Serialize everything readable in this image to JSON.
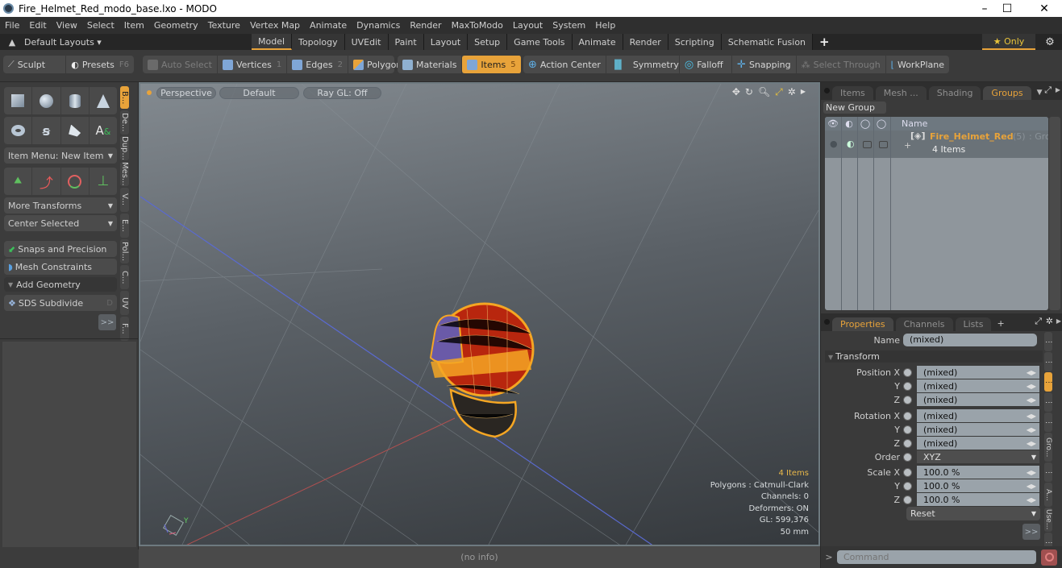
{
  "window": {
    "title": "Fire_Helmet_Red_modo_base.lxo - MODO",
    "controls": {
      "minimize": "–",
      "maximize": "☐",
      "close": "✕"
    }
  },
  "menu": [
    "File",
    "Edit",
    "View",
    "Select",
    "Item",
    "Geometry",
    "Texture",
    "Vertex Map",
    "Animate",
    "Dynamics",
    "Render",
    "MaxToModo",
    "Layout",
    "System",
    "Help"
  ],
  "layouts": {
    "selector": "Default Layouts ▾",
    "tabs": [
      "Model",
      "Topology",
      "UVEdit",
      "Paint",
      "Layout",
      "Setup",
      "Game Tools",
      "Animate",
      "Render",
      "Scripting",
      "Schematic Fusion"
    ],
    "active_tab": "Model",
    "add": "+",
    "only": "★ Only",
    "gear": "⚙"
  },
  "toolbar": {
    "sculpt": "Sculpt",
    "presets": "Presets",
    "presets_key": "F6",
    "auto_select": "Auto Select",
    "vertices": "Vertices",
    "vertices_key": "1",
    "edges": "Edges",
    "edges_key": "2",
    "polygons": "Polygons",
    "materials": "Materials",
    "items": "Items",
    "items_key": "5",
    "action_center": "Action Center",
    "symmetry": "Symmetry",
    "falloff": "Falloff",
    "snapping": "Snapping",
    "select_through": "Select Through",
    "workplane": "WorkPlane"
  },
  "left_panel": {
    "item_menu": "Item Menu: New Item",
    "more_transforms": "More Transforms",
    "center_selected": "Center Selected",
    "snaps_precision": "Snaps and Precision",
    "mesh_constraints": "Mesh Constraints",
    "add_geometry": "Add Geometry",
    "sds_subdivide": "SDS Subdivide",
    "sds_key": "D",
    "more": ">>",
    "vtabs": [
      "B...",
      "De...",
      "Dup...",
      "Mes...",
      "V...",
      "E...",
      "Pol...",
      "C...",
      "UV",
      "F..."
    ]
  },
  "viewport": {
    "view": "Perspective",
    "shading": "Default",
    "raygl": "Ray GL: Off",
    "info": {
      "items": "4 Items",
      "polygons": "Polygons : Catmull-Clark",
      "channels": "Channels: 0",
      "deformers": "Deformers: ON",
      "gl": "GL: 599,376",
      "scale": "50 mm"
    },
    "status": "(no info)"
  },
  "groups_panel": {
    "tabs": [
      "Items",
      "Mesh ...",
      "Shading",
      "Groups"
    ],
    "active_tab": "Groups",
    "new_group": "New Group",
    "column_name": "Name",
    "group": {
      "name": "Fire_Helmet_Red",
      "count": "(5)",
      "type": ": Group",
      "sub": "4 Items"
    }
  },
  "properties_panel": {
    "tabs": [
      "Properties",
      "Channels",
      "Lists",
      "+"
    ],
    "active_tab": "Properties",
    "name_label": "Name",
    "name_value": "(mixed)",
    "transform": "Transform",
    "rows": [
      {
        "label": "Position X",
        "value": "(mixed)"
      },
      {
        "label": "Y",
        "value": "(mixed)"
      },
      {
        "label": "Z",
        "value": "(mixed)"
      },
      {
        "label": "Rotation X",
        "value": "(mixed)"
      },
      {
        "label": "Y",
        "value": "(mixed)"
      },
      {
        "label": "Z",
        "value": "(mixed)"
      },
      {
        "label": "Order",
        "value": "XYZ"
      },
      {
        "label": "Scale X",
        "value": "100.0 %"
      },
      {
        "label": "Y",
        "value": "100.0 %"
      },
      {
        "label": "Z",
        "value": "100.0 %"
      }
    ],
    "reset": "Reset",
    "more": ">>",
    "rvtabs": [
      "⋮",
      "⋮",
      "⋮",
      "⋮",
      "⋮",
      "Gro...",
      "⋮",
      "A...",
      "Use...",
      "⋮"
    ],
    "command_placeholder": "Command",
    "command_prompt": ">"
  },
  "colors": {
    "accent": "#e8a33a",
    "wire": "#f5a623",
    "helmet": "#b8260e"
  }
}
